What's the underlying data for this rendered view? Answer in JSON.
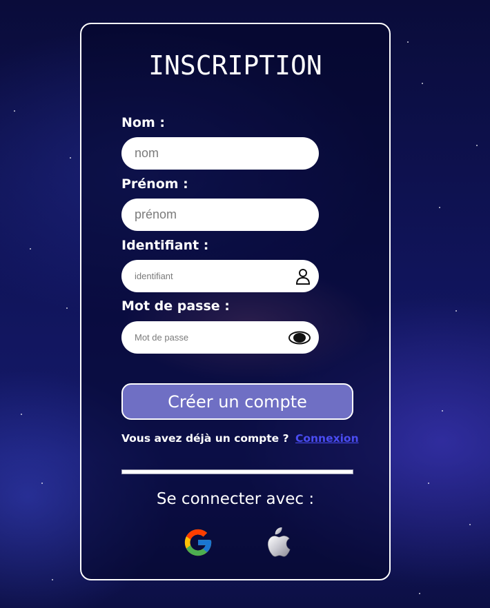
{
  "form": {
    "title": "INSCRIPTION",
    "fields": [
      {
        "label": "Nom :",
        "placeholder": "nom"
      },
      {
        "label": "Prénom :",
        "placeholder": "prénom"
      },
      {
        "label": "Identifiant :",
        "placeholder": "identifiant",
        "icon": "user-icon"
      },
      {
        "label": "Mot de passe :",
        "placeholder": "Mot de passe",
        "icon": "eye-icon"
      }
    ],
    "submit_label": "Créer un compte",
    "have_account_text": "Vous avez déjà un compte ?",
    "login_link": "Connexion",
    "connect_with": "Se connecter avec :",
    "social": [
      "google-icon",
      "apple-icon"
    ]
  },
  "colors": {
    "button": "#6f6fc4",
    "link": "#4a4cf2",
    "card_border": "#ffffff"
  }
}
